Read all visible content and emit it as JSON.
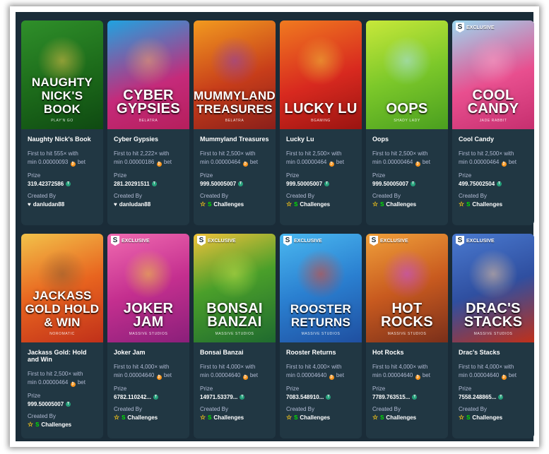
{
  "labels": {
    "prize": "Prize",
    "created_by": "Created By",
    "bet_suffix": "bet"
  },
  "colors": {
    "panel_bg": "#1a2c38",
    "card_bg": "#213743",
    "muted_text": "#b1bad3",
    "tether": "#26a17b",
    "btc": "#f7931a",
    "star": "#f5c518"
  },
  "cards": [
    {
      "game": "Naughty Nick's Book",
      "art_title": "NAUGHTY NICK'S BOOK",
      "provider": "PLAY'N GO",
      "exclusive": "",
      "line1": "First to hit 555× with",
      "min": "min 0.00000093",
      "prize": "319.42372586",
      "creator": "danludan88",
      "creator_icon": "heart-icon",
      "bg": "linear-gradient(160deg,#2f8f2a 0%,#1c6a1a 55%,#0f4a12 100%)",
      "accent": "#e9c24a"
    },
    {
      "game": "Cyber Gypsies",
      "art_title": "CYBER GYPSIES",
      "provider": "BELATRA",
      "exclusive": "",
      "line1": "First to hit 2,222× with",
      "min": "min 0.00000186",
      "prize": "281.20291511",
      "creator": "danludan88",
      "creator_icon": "heart-icon",
      "bg": "linear-gradient(160deg,#1fa3e0 0%,#c52a7a 60%,#b51f5c 100%)",
      "accent": "#f1a66b"
    },
    {
      "game": "Mummyland Treasures",
      "art_title": "MUMMYLAND TREASURES",
      "provider": "BELATRA",
      "exclusive": "",
      "line1": "First to hit 2,500× with",
      "min": "min 0.00000464",
      "prize": "999.50005007",
      "creator": "Challenges",
      "creator_icon": "star-icon",
      "bg": "linear-gradient(160deg,#f29a1f 0%,#c73d1a 55%,#8a1f1a 100%)",
      "accent": "#8b3fb8"
    },
    {
      "game": "Lucky Lu",
      "art_title": "LUCKY LU",
      "provider": "BGAMING",
      "exclusive": "",
      "line1": "First to hit 2,500× with",
      "min": "min 0.00000464",
      "prize": "999.50005007",
      "creator": "Challenges",
      "creator_icon": "star-icon",
      "bg": "linear-gradient(160deg,#f07a1f 0%,#d8291f 55%,#9a1411 100%)",
      "accent": "#f0c23a"
    },
    {
      "game": "Oops",
      "art_title": "OOPS",
      "provider": "SHADY LADY",
      "exclusive": "",
      "line1": "First to hit 2,500× with",
      "min": "min 0.00000464",
      "prize": "999.50005007",
      "creator": "Challenges",
      "creator_icon": "star-icon",
      "bg": "linear-gradient(160deg,#c8e83a 0%,#7cc82a 50%,#4a9f1f 100%)",
      "accent": "#aee3f5"
    },
    {
      "game": "Cool Candy",
      "art_title": "COOL CANDY",
      "provider": "JADE RABBIT",
      "exclusive": "EXCLUSIVE",
      "line1": "First to hit 2,500× with",
      "min": "min 0.00000464",
      "prize": "499.75002504",
      "creator": "Challenges",
      "creator_icon": "star-icon",
      "bg": "linear-gradient(160deg,#9ad8f0 0%,#e84f8f 55%,#c62f6f 100%)",
      "accent": "#ff9ec4"
    },
    {
      "game": "Jackass Gold: Hold and Win",
      "art_title": "JACKASS GOLD HOLD & WIN",
      "provider": "NOROMATIC",
      "exclusive": "",
      "line1": "First to hit 2,500× with",
      "min": "min 0.00000464",
      "prize": "999.50005007",
      "creator": "Challenges",
      "creator_icon": "star-icon",
      "bg": "linear-gradient(160deg,#f2c24a 0%,#e8641f 50%,#c0301a 100%)",
      "accent": "#8a5a2f"
    },
    {
      "game": "Joker Jam",
      "art_title": "JOKER JAM",
      "provider": "MASSIVE STUDIOS",
      "exclusive": "EXCLUSIVE",
      "line1": "First to hit 4,000× with",
      "min": "min 0.00004640",
      "prize": "6782.110242...",
      "creator": "Challenges",
      "creator_icon": "star-icon",
      "bg": "linear-gradient(160deg,#f06ab0 0%,#c42f8f 50%,#8a1f7a 100%)",
      "accent": "#f0d23a"
    },
    {
      "game": "Bonsai Banzai",
      "art_title": "BONSAI BANZAI",
      "provider": "MASSIVE STUDIOS",
      "exclusive": "EXCLUSIVE",
      "line1": "First to hit 4,000× with",
      "min": "min 0.00004640",
      "prize": "14971.53379...",
      "creator": "Challenges",
      "creator_icon": "star-icon",
      "bg": "linear-gradient(160deg,#f0c23a 0%,#4a9f2a 45%,#1f6a2f 100%)",
      "accent": "#c0e04a"
    },
    {
      "game": "Rooster Returns",
      "art_title": "ROOSTER RETURNS",
      "provider": "MASSIVE STUDIOS",
      "exclusive": "EXCLUSIVE",
      "line1": "First to hit 4,000× with",
      "min": "min 0.00004640",
      "prize": "7083.548910...",
      "creator": "Challenges",
      "creator_icon": "star-icon",
      "bg": "linear-gradient(160deg,#4ab8f0 0%,#2a7fd0 50%,#1f4fa0 100%)",
      "accent": "#e8401f"
    },
    {
      "game": "Hot Rocks",
      "art_title": "HOT ROCKS",
      "provider": "MASSIVE STUDIOS",
      "exclusive": "EXCLUSIVE",
      "line1": "First to hit 4,000× with",
      "min": "min 0.00004640",
      "prize": "7789.763515...",
      "creator": "Challenges",
      "creator_icon": "star-icon",
      "bg": "linear-gradient(160deg,#f0a03a 0%,#c85a1f 50%,#7a2f1a 100%)",
      "accent": "#c04af0"
    },
    {
      "game": "Drac's Stacks",
      "art_title": "DRAC'S STACKS",
      "provider": "MASSIVE STUDIOS",
      "exclusive": "EXCLUSIVE",
      "line1": "First to hit 4,000× with",
      "min": "min 0.00004640",
      "prize": "7558.248865...",
      "creator": "Challenges",
      "creator_icon": "star-icon",
      "bg": "linear-gradient(160deg,#4a7ad0 0%,#2f4fa0 50%,#c0301a 100%)",
      "accent": "#f0c8a0"
    }
  ]
}
